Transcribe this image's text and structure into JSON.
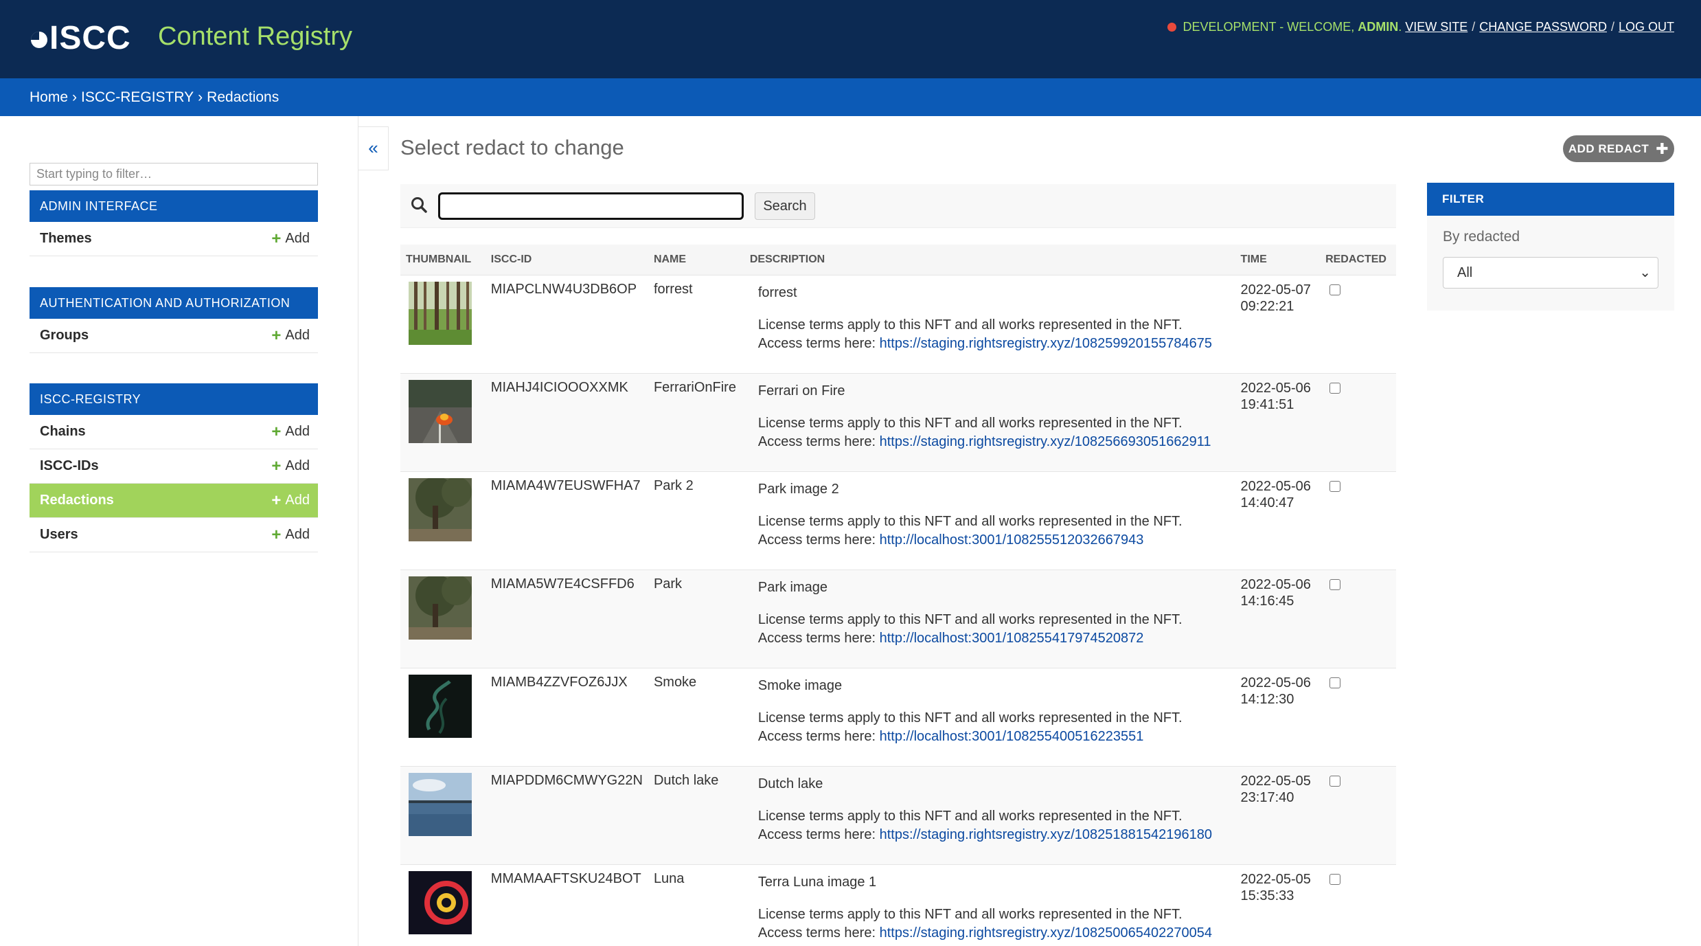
{
  "header": {
    "logo_text": "ISCC",
    "site_name": "Content Registry",
    "user_tools": {
      "env_status": "DEVELOPMENT - WELCOME,",
      "username": "ADMIN",
      "view_site": "VIEW SITE",
      "change_password": "CHANGE PASSWORD",
      "log_out": "LOG OUT",
      "separator": "/"
    }
  },
  "breadcrumbs": {
    "home": "Home",
    "app": "ISCC-REGISTRY",
    "current": "Redactions",
    "separator": "›"
  },
  "sidebar": {
    "filter_placeholder": "Start typing to filter…",
    "modules": [
      {
        "caption": "ADMIN INTERFACE",
        "models": [
          {
            "name": "Themes",
            "add_label": "Add",
            "active": false
          }
        ]
      },
      {
        "caption": "AUTHENTICATION AND AUTHORIZATION",
        "models": [
          {
            "name": "Groups",
            "add_label": "Add",
            "active": false
          }
        ]
      },
      {
        "caption": "ISCC-REGISTRY",
        "models": [
          {
            "name": "Chains",
            "add_label": "Add",
            "active": false
          },
          {
            "name": "ISCC-IDs",
            "add_label": "Add",
            "active": false
          },
          {
            "name": "Redactions",
            "add_label": "Add",
            "active": true
          },
          {
            "name": "Users",
            "add_label": "Add",
            "active": false
          }
        ]
      }
    ],
    "collapse_glyph": "«"
  },
  "content": {
    "title": "Select redact to change",
    "add_button": "ADD REDACT",
    "search": {
      "value": "",
      "button_label": "Search"
    },
    "columns": [
      "THUMBNAIL",
      "ISCC-ID",
      "NAME",
      "DESCRIPTION",
      "TIME",
      "REDACTED"
    ],
    "license_text": "License terms apply to this NFT and all works represented in the NFT.",
    "access_prefix": "Access terms here: ",
    "rows": [
      {
        "iscc_id": "MIAPCLNW4U3DB6OP",
        "name": "forrest",
        "desc_title": "forrest",
        "url": "https://staging.rightsregistry.xyz/108259920155784675",
        "date": "2022-05-07",
        "time": "09:22:21",
        "redacted": false,
        "thumb": "forest"
      },
      {
        "iscc_id": "MIAHJ4ICIOOOXXMK",
        "name": "FerrariOnFire",
        "desc_title": "Ferrari on Fire",
        "url": "https://staging.rightsregistry.xyz/108256693051662911",
        "date": "2022-05-06",
        "time": "19:41:51",
        "redacted": false,
        "thumb": "fire"
      },
      {
        "iscc_id": "MIAMA4W7EUSWFHA7",
        "name": "Park 2",
        "desc_title": "Park image 2",
        "url": "http://localhost:3001/108255512032667943",
        "date": "2022-05-06",
        "time": "14:40:47",
        "redacted": false,
        "thumb": "park"
      },
      {
        "iscc_id": "MIAMA5W7E4CSFFD6",
        "name": "Park",
        "desc_title": "Park image",
        "url": "http://localhost:3001/108255417974520872",
        "date": "2022-05-06",
        "time": "14:16:45",
        "redacted": false,
        "thumb": "park"
      },
      {
        "iscc_id": "MIAMB4ZZVFOZ6JJX",
        "name": "Smoke",
        "desc_title": "Smoke image",
        "url": "http://localhost:3001/108255400516223551",
        "date": "2022-05-06",
        "time": "14:12:30",
        "redacted": false,
        "thumb": "smoke"
      },
      {
        "iscc_id": "MIAPDDM6CMWYG22N",
        "name": "Dutch lake",
        "desc_title": "Dutch lake",
        "url": "https://staging.rightsregistry.xyz/108251881542196180",
        "date": "2022-05-05",
        "time": "23:17:40",
        "redacted": false,
        "thumb": "lake"
      },
      {
        "iscc_id": "MMAMAAFTSKU24BOT",
        "name": "Luna",
        "desc_title": "Terra Luna image 1",
        "url": "https://staging.rightsregistry.xyz/108250065402270054",
        "date": "2022-05-05",
        "time": "15:35:33",
        "redacted": false,
        "thumb": "luna"
      }
    ]
  },
  "filter": {
    "caption": "FILTER",
    "label": "By redacted",
    "selected": "All"
  },
  "colors": {
    "header_bg": "#0c2a53",
    "breadcrumb_bg": "#0c5ab6",
    "accent_green": "#a6e06a",
    "active_row": "#a1d35b",
    "status_dot": "#e84a3c"
  }
}
